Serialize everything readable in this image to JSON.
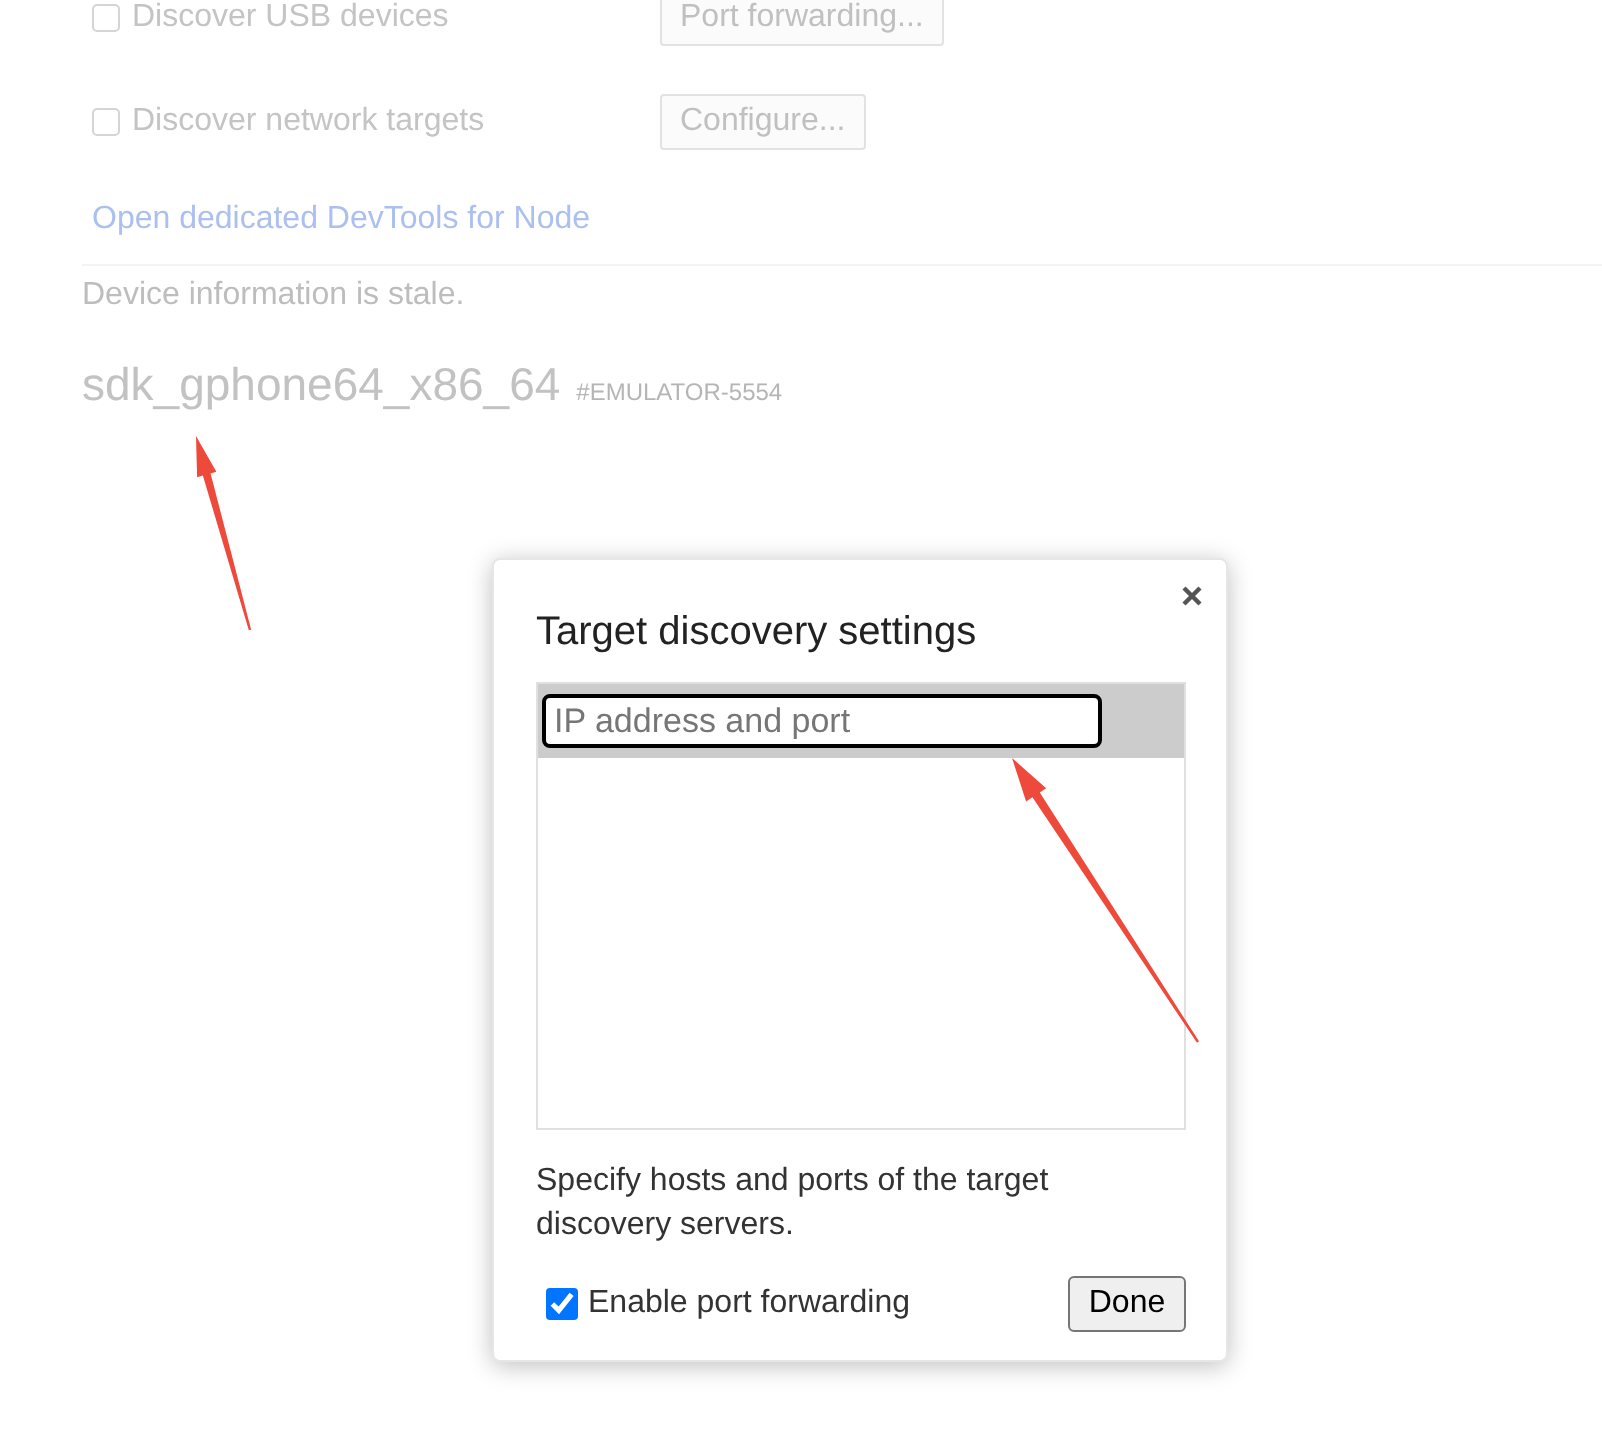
{
  "background": {
    "options": [
      {
        "label": "Discover USB devices",
        "checked": false,
        "button": "Port forwarding..."
      },
      {
        "label": "Discover network targets",
        "checked": false,
        "button": "Configure..."
      }
    ],
    "link": "Open dedicated DevTools for Node",
    "notice": "Device information is stale.",
    "device": {
      "name": "sdk_gphone64_x86_64",
      "serial": "#EMULATOR-5554"
    }
  },
  "dialog": {
    "title": "Target discovery settings",
    "entries": [
      {
        "placeholder": "IP address and port",
        "selected": true
      }
    ],
    "description": "Specify hosts and ports of the target discovery servers.",
    "port_forwarding": {
      "label": "Enable port forwarding",
      "checked": true
    },
    "done": "Done"
  }
}
